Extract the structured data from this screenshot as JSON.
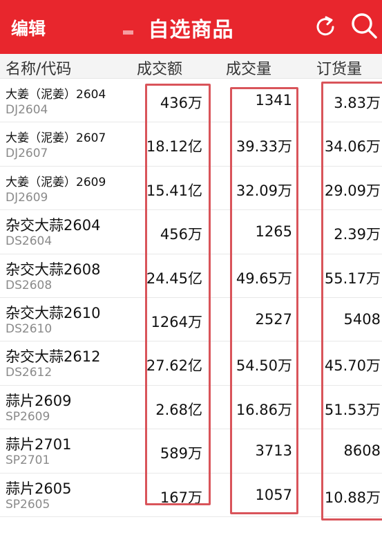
{
  "header": {
    "edit_label": "编辑",
    "title": "自选商品",
    "refresh_icon": "refresh-icon",
    "search_icon": "search-icon",
    "bg_color": "#e8262d"
  },
  "columns": {
    "name": "名称/代码",
    "amount": "成交额",
    "volume": "成交量",
    "open_interest": "订货量"
  },
  "rows": [
    {
      "name": "大姜（泥姜）2604",
      "code": "DJ2604",
      "amount": "436万",
      "volume": "1341",
      "open_interest": "3.83万"
    },
    {
      "name": "大姜（泥姜）2607",
      "code": "DJ2607",
      "amount": "18.12亿",
      "volume": "39.33万",
      "open_interest": "34.06万"
    },
    {
      "name": "大姜（泥姜）2609",
      "code": "DJ2609",
      "amount": "15.41亿",
      "volume": "32.09万",
      "open_interest": "29.09万"
    },
    {
      "name": "杂交大蒜2604",
      "code": "DS2604",
      "amount": "456万",
      "volume": "1265",
      "open_interest": "2.39万"
    },
    {
      "name": "杂交大蒜2608",
      "code": "DS2608",
      "amount": "24.45亿",
      "volume": "49.65万",
      "open_interest": "55.17万"
    },
    {
      "name": "杂交大蒜2610",
      "code": "DS2610",
      "amount": "1264万",
      "volume": "2527",
      "open_interest": "5408"
    },
    {
      "name": "杂交大蒜2612",
      "code": "DS2612",
      "amount": "27.62亿",
      "volume": "54.50万",
      "open_interest": "45.70万"
    },
    {
      "name": "蒜片2609",
      "code": "SP2609",
      "amount": "2.68亿",
      "volume": "16.86万",
      "open_interest": "51.53万"
    },
    {
      "name": "蒜片2701",
      "code": "SP2701",
      "amount": "589万",
      "volume": "3713",
      "open_interest": "8608"
    },
    {
      "name": "蒜片2605",
      "code": "SP2605",
      "amount": "167万",
      "volume": "1057",
      "open_interest": "10.88万"
    }
  ],
  "highlight_color": "#d9545a"
}
